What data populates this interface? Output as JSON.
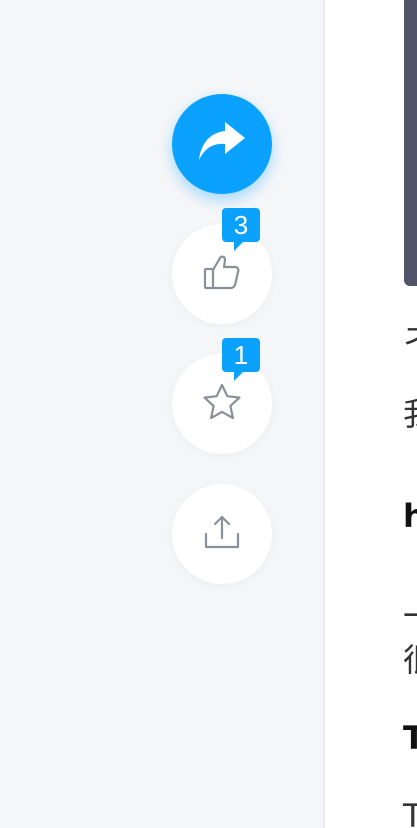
{
  "actions": {
    "forward_icon": "forward-arrow",
    "like": {
      "icon": "thumbs-up",
      "count": "3"
    },
    "favorite": {
      "icon": "star",
      "count": "1"
    },
    "share_icon": "share-upload"
  },
  "article": {
    "lines": [
      {
        "text": "ネ"
      },
      {
        "text": "我"
      },
      {
        "text": "h"
      },
      {
        "text": "一"
      },
      {
        "text": "很"
      },
      {
        "text": "T"
      },
      {
        "text": "T"
      }
    ]
  },
  "colors": {
    "accent": "#0ba2ff",
    "icon": "#8a9099",
    "rail_bg": "#f5f6f8",
    "code_bg": "#4f5567"
  }
}
